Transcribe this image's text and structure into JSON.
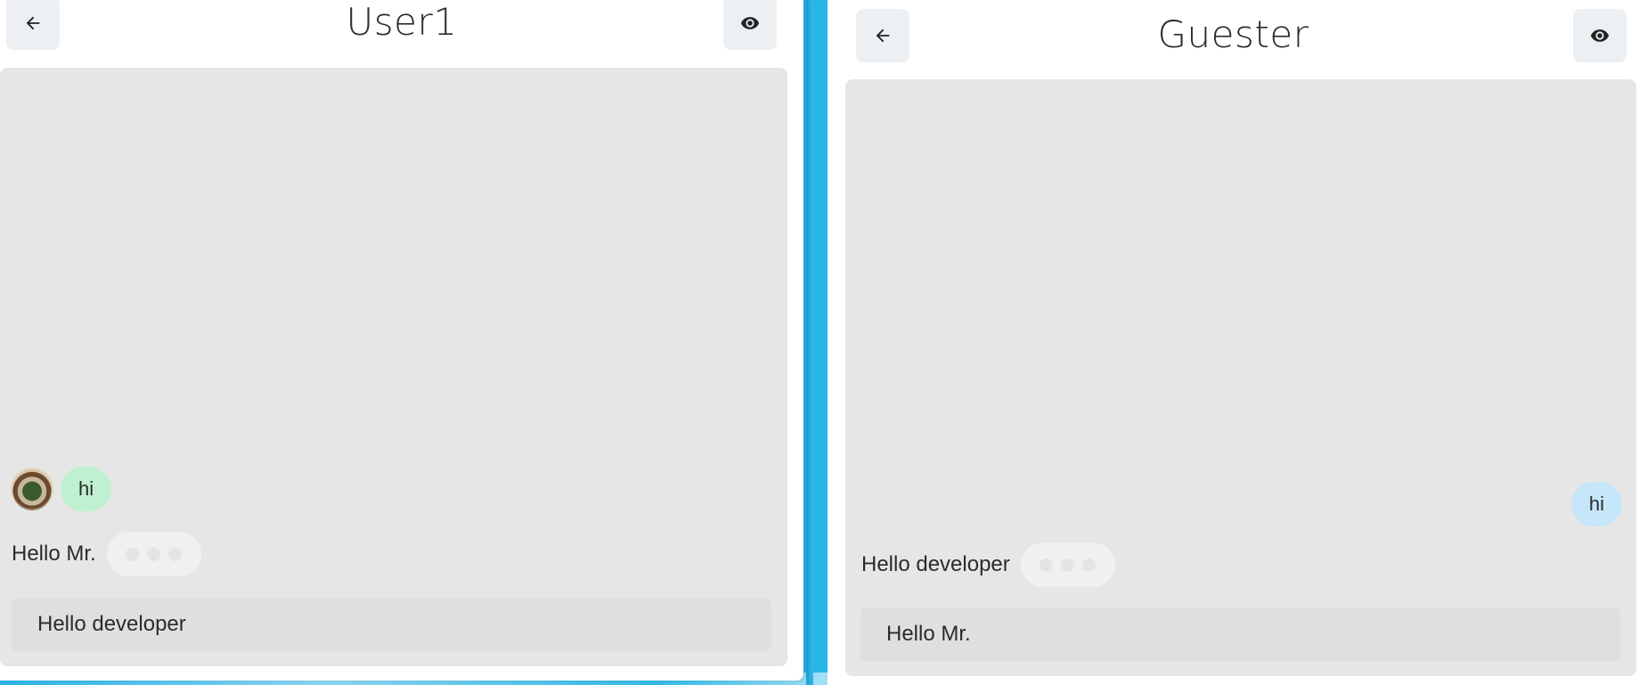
{
  "left_panel": {
    "title": "User1",
    "back_icon": "arrow-left-icon",
    "view_icon": "eye-icon",
    "messages": [
      {
        "text": "hi",
        "side": "incoming",
        "color": "#bff0cf",
        "has_avatar": true
      }
    ],
    "typing_label": "Hello Mr.",
    "input_value": "Hello developer"
  },
  "right_panel": {
    "title": "Guester",
    "back_icon": "arrow-left-icon",
    "view_icon": "eye-icon",
    "messages": [
      {
        "text": "hi",
        "side": "outgoing",
        "color": "#c6e6fa"
      }
    ],
    "typing_label": "Hello developer",
    "input_value": "Hello Mr."
  },
  "colors": {
    "background": "#28b6e8",
    "chat_area": "#e6e6e6",
    "input": "#dfdfdf",
    "incoming_bubble": "#bff0cf",
    "outgoing_bubble": "#c6e6fa"
  }
}
